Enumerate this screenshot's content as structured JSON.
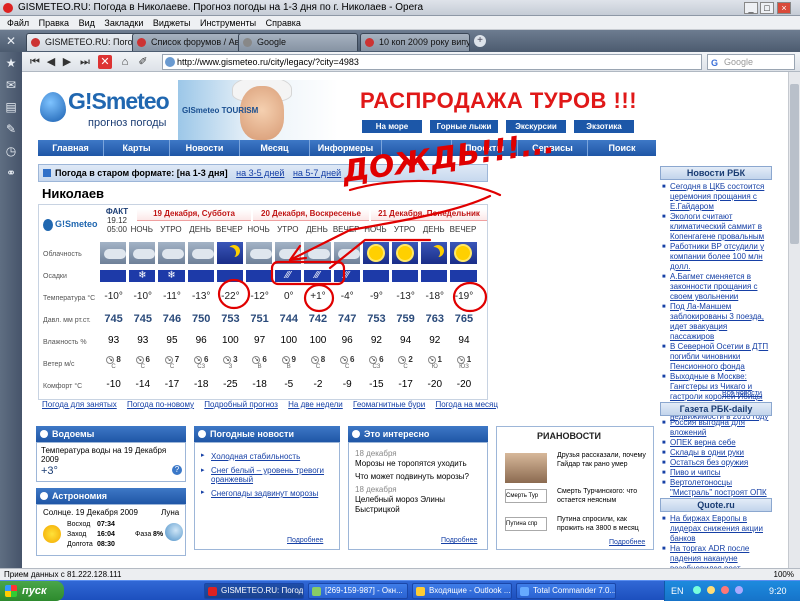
{
  "window": {
    "title": "GISMETEO.RU: Погода в Николаеве. Прогноз погоды на 1-3 дня по г. Николаев - Opera"
  },
  "menu": [
    "Файл",
    "Правка",
    "Вид",
    "Закладки",
    "Виджеты",
    "Инструменты",
    "Справка"
  ],
  "tabs": [
    {
      "label": "GISMETEO.RU: Погода ..."
    },
    {
      "label": "Список форумов / Авт..."
    },
    {
      "label": "Google"
    },
    {
      "label": "10 коп 2009 року випу..."
    }
  ],
  "address": {
    "url": "http://www.gismeteo.ru/city/legacy/?city=4983",
    "search_placeholder": "Google"
  },
  "banner": {
    "logo": "G!Smeteo",
    "logo_sub": "прогноз погоды",
    "tourism": "GISmeteo TOURISM",
    "ad_title": "РАСПРОДАЖА ТУРОВ !!!",
    "ad_buttons": [
      "На море",
      "Горные лыжи",
      "Экскурсии",
      "Экзотика"
    ]
  },
  "nav": [
    "Главная",
    "Карты",
    "Новости",
    "Месяц",
    "Информеры",
    "",
    "Проекты",
    "Сервисы",
    "Поиск"
  ],
  "old_format": {
    "label": "Погода в старом формате:",
    "current": "[на 1-3 дня]",
    "l1": "на 3-5 дней",
    "l2": "на 5-7 дней"
  },
  "city": "Николаев",
  "forecast": {
    "fact_label": "ФАКТ",
    "fact_date": "19.12",
    "fact_time": "05:00",
    "days": [
      "19 Декабря, Суббота",
      "20 Декабря, Воскресенье",
      "21 Декабря, Понедельник"
    ],
    "times": [
      "НОЧЬ",
      "УТРО",
      "ДЕНЬ",
      "ВЕЧЕР",
      "НОЧЬ",
      "УТРО",
      "ДЕНЬ",
      "ВЕЧЕР",
      "НОЧЬ",
      "УТРО",
      "ДЕНЬ",
      "ВЕЧЕР"
    ],
    "row_labels": {
      "cloud": "Облачность",
      "precip": "Осадки",
      "temp": "Температура °С",
      "pres": "Давл. мм рт.ст.",
      "hum": "Влажность %",
      "wind": "Ветер м/с",
      "comf": "Комфорт °С"
    },
    "cloud": [
      "cloud",
      "cloud",
      "cloud",
      "cloud",
      "moon",
      "cloud",
      "cloud",
      "cloud",
      "cloud",
      "sun",
      "sun",
      "moon",
      "sun"
    ],
    "precip": [
      "none",
      "snow",
      "snow",
      "none",
      "none",
      "none",
      "rain",
      "rain",
      "rain",
      "none",
      "none",
      "none",
      "none"
    ],
    "temp": [
      "-10°",
      "-10°",
      "-11°",
      "-13°",
      "-22°",
      "-12°",
      "0°",
      "+1°",
      "-4°",
      "-9°",
      "-13°",
      "-18°",
      "-19°"
    ],
    "pres": [
      "745",
      "745",
      "746",
      "750",
      "753",
      "751",
      "744",
      "742",
      "747",
      "753",
      "759",
      "763",
      "765"
    ],
    "hum": [
      "93",
      "93",
      "95",
      "96",
      "100",
      "97",
      "100",
      "100",
      "96",
      "92",
      "94",
      "92",
      "94"
    ],
    "wind_speed": [
      "8",
      "6",
      "7",
      "6",
      "3",
      "6",
      "9",
      "8",
      "6",
      "6",
      "2",
      "1",
      "1"
    ],
    "wind_dir": [
      "С",
      "С",
      "С",
      "СЗ",
      "З",
      "В",
      "В",
      "С",
      "С",
      "СЗ",
      "С",
      "Ю",
      "ЮЗ"
    ],
    "comf": [
      "-10",
      "-14",
      "-17",
      "-18",
      "-25",
      "-18",
      "-5",
      "-2",
      "-9",
      "-15",
      "-17",
      "-20",
      "-20"
    ],
    "footer_links": [
      "Погода для занятых",
      "Погода по-новому",
      "Подробный прогноз",
      "На две недели",
      "Геомагнитные бури",
      "Погода на месяц"
    ]
  },
  "annotation": {
    "text": "ДОЖДЬ!!!..."
  },
  "water": {
    "title": "Водоемы",
    "text": "Температура воды на 19 Декабря 2009",
    "value": "+3°"
  },
  "astro": {
    "title": "Астрономия",
    "date": "Солнце. 19 Декабря 2009",
    "moon_label": "Луна",
    "rise_label": "Восход",
    "rise": "07:34",
    "set_label": "Заход",
    "set": "16:04",
    "len_label": "Долгота",
    "len": "08:30",
    "phase_label": "Фаза",
    "phase": "8%"
  },
  "weather_news": {
    "title": "Погодные новости",
    "items": [
      "Холодная стабильность",
      "Снег белый – уровень тревоги оранжевый",
      "Снегопады задвинут морозы"
    ],
    "more": "Подробнее"
  },
  "interesting": {
    "title": "Это интересно",
    "items": [
      {
        "date": "18 декабря",
        "text": "Морозы не торопятся уходить"
      },
      {
        "date": "",
        "text": "Что может подвинуть морозы?"
      },
      {
        "date": "18 декабря",
        "text": "Целебный мороз Элины Быстрицкой"
      }
    ],
    "more": "Подробнее"
  },
  "ria": {
    "logo": "РИАНОВОСТИ",
    "items": [
      "Друзья рассказали, почему Гайдар так рано умер",
      "Смерть Турчинского: что остается неясным",
      "Путина спросили, как прожить на 3800 в месяц"
    ],
    "thumb2": "Смерть Тур",
    "thumb3": "Путина спр",
    "more": "Подробнее"
  },
  "rbk": {
    "title": "Новости РБК",
    "items": [
      "Сегодня в ЦКБ состоится церемония прощания с Е.Гайдаром",
      "Экологи считают климатический саммит в Копенгагене провальным",
      "Работники ВР отсудили у компании более 100 млн долл.",
      "А.Багмет сменяется в законности прощания с своем увольнении",
      "Под Ла-Маншем заблокированы 3 поезда, идет эвакуация пассажиров",
      "В Северной Осетии в ДТП погибли чиновники Пенсионного фонда",
      "Выходные в Москве: Гангстеры из Чикаго и гастроли королей Ибицы",
      "Пять прогнозов о рынке недвижимости в 2010 году"
    ],
    "all": "Все новости"
  },
  "rbk_daily": {
    "title": "Газета РБК-daily",
    "items": [
      "Россия выгодна для вложений",
      "ОПЕК верна себе",
      "Склады в одни руки",
      "Остаться без оружия",
      "Пиво и чипсы",
      "Вертолетоносцы \"Мистраль\" построят ОПК"
    ]
  },
  "quote": {
    "title": "Quote.ru",
    "items": [
      "На биржах Европы в лидерах снижения акции банков",
      "На торгах ADR после падения накануне возобновился рост котировок"
    ]
  },
  "status": {
    "text": "Прием данных с 81.222.128.111",
    "zoom": "100%"
  },
  "taskbar": {
    "start": "пуск",
    "tasks": [
      "GISMETEO.RU: Погод...",
      "[269-159-987] - Окн...",
      "Входящие - Outlook ...",
      "Total Commander 7.0..."
    ],
    "lang": "EN",
    "clock": "9:20"
  },
  "colors": {
    "accent": "#1f56a6",
    "brand_red": "#e01818",
    "annotation": "#e00000"
  }
}
